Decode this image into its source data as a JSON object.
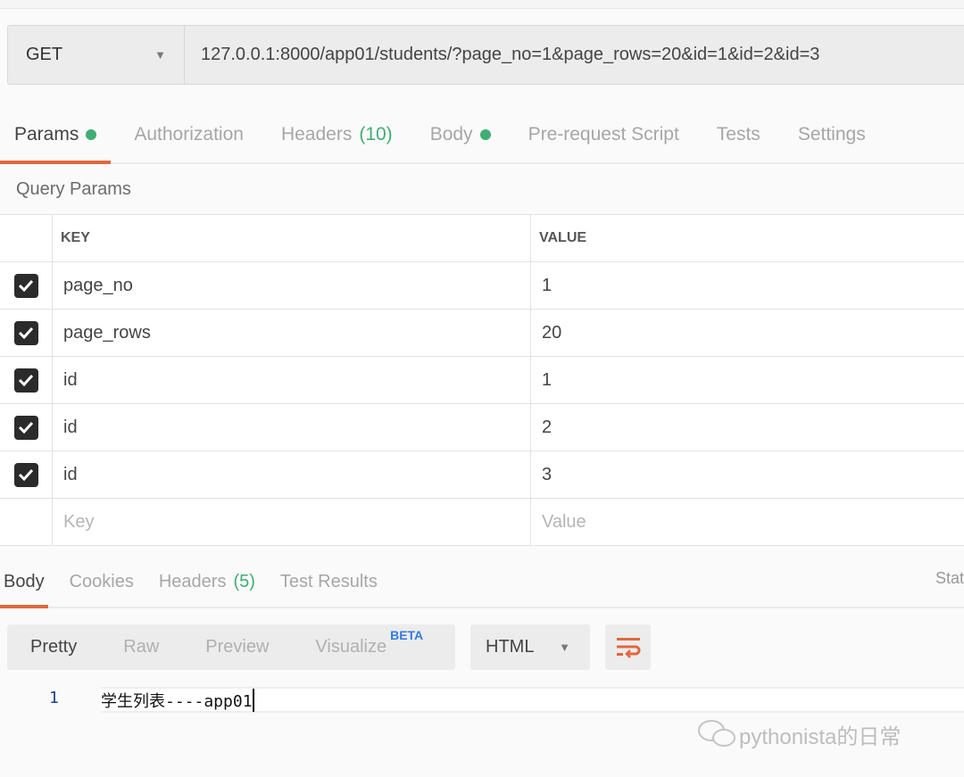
{
  "request": {
    "method": "GET",
    "url": "127.0.0.1:8000/app01/students/?page_no=1&page_rows=20&id=1&id=2&id=3"
  },
  "request_tabs": [
    {
      "label": "Params",
      "dot": true
    },
    {
      "label": "Authorization"
    },
    {
      "label": "Headers",
      "count": "(10)"
    },
    {
      "label": "Body",
      "dot": true
    },
    {
      "label": "Pre-request Script"
    },
    {
      "label": "Tests"
    },
    {
      "label": "Settings"
    }
  ],
  "query_params": {
    "title": "Query Params",
    "headers": {
      "key": "KEY",
      "value": "VALUE"
    },
    "rows": [
      {
        "key": "page_no",
        "value": "1",
        "checked": true
      },
      {
        "key": "page_rows",
        "value": "20",
        "checked": true
      },
      {
        "key": "id",
        "value": "1",
        "checked": true
      },
      {
        "key": "id",
        "value": "2",
        "checked": true
      },
      {
        "key": "id",
        "value": "3",
        "checked": true
      }
    ],
    "placeholder": {
      "key": "Key",
      "value": "Value"
    }
  },
  "response_tabs": [
    {
      "label": "Body"
    },
    {
      "label": "Cookies"
    },
    {
      "label": "Headers",
      "count": "(5)"
    },
    {
      "label": "Test Results"
    }
  ],
  "status_label": "Stat",
  "view_modes": {
    "pretty": "Pretty",
    "raw": "Raw",
    "preview": "Preview",
    "visualize": "Visualize",
    "beta": "BETA"
  },
  "format": "HTML",
  "editor": {
    "line_number": "1",
    "content": "学生列表----app01"
  },
  "watermark": "pythonista的日常",
  "colors": {
    "accent": "#e2673c",
    "green": "#3fae72",
    "beta": "#2f7be0"
  }
}
